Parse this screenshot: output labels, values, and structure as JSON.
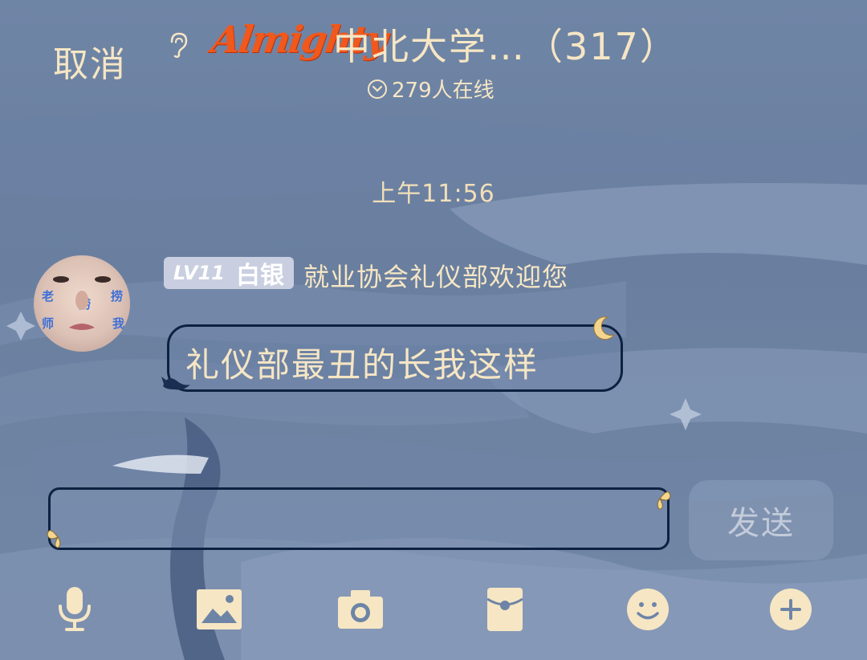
{
  "header": {
    "cancel_label": "取消",
    "logo_text": "Almighty",
    "group_name": "中北大学…",
    "member_count": "（317）",
    "online_text": "279人在线"
  },
  "chat": {
    "timestamp": "上午11:56",
    "message": {
      "level": "LV11",
      "rank": "白银",
      "sender_text": "就业协会礼仪部欢迎您",
      "bubble_text": "礼仪部最丑的长我这样",
      "avatar_chars": [
        "老",
        "师",
        "捞",
        "捞",
        "我"
      ]
    }
  },
  "composer": {
    "input_value": "",
    "send_label": "发送"
  },
  "toolbar": {
    "icons": [
      "microphone-icon",
      "image-icon",
      "camera-icon",
      "red-packet-icon",
      "emoji-icon",
      "plus-icon"
    ]
  },
  "colors": {
    "text_cream": "#f6e6c4",
    "logo_orange": "#f0581c",
    "border_navy": "#0e2140",
    "background_blue": "#6f85a6"
  }
}
